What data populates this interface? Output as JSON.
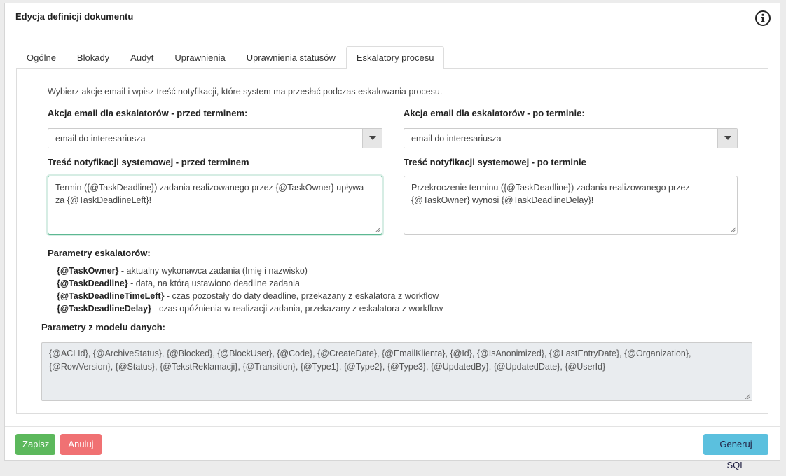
{
  "header": {
    "title": "Edycja definicji dokumentu",
    "info_icon": "info-circle-icon"
  },
  "tabs": [
    {
      "label": "Ogólne",
      "active": false
    },
    {
      "label": "Blokady",
      "active": false
    },
    {
      "label": "Audyt",
      "active": false
    },
    {
      "label": "Uprawnienia",
      "active": false
    },
    {
      "label": "Uprawnienia statusów",
      "active": false
    },
    {
      "label": "Eskalatory procesu",
      "active": true
    }
  ],
  "content": {
    "intro": "Wybierz akcje email i wpisz treść notyfikacji, które system ma przesłać podczas eskalowania procesu.",
    "before": {
      "email_label": "Akcja email dla eskalatorów - przed terminem:",
      "email_value": "email do interesariusza",
      "notif_label": "Treść notyfikacji systemowej - przed terminem",
      "notif_text": "Termin ({@TaskDeadline}) zadania realizowanego przez {@TaskOwner} upływa za {@TaskDeadlineLeft}!"
    },
    "after": {
      "email_label": "Akcja email dla eskalatorów - po terminie:",
      "email_value": "email do interesariusza",
      "notif_label": "Treść notyfikacji systemowej - po terminie",
      "notif_text": "Przekroczenie terminu ({@TaskDeadline}) zadania realizowanego przez {@TaskOwner} wynosi {@TaskDeadlineDelay}!"
    },
    "params_title": "Parametry eskalatorów:",
    "params": [
      {
        "name": "{@TaskOwner}",
        "desc": " - aktualny wykonawca zadania (Imię i nazwisko)"
      },
      {
        "name": "{@TaskDeadline}",
        "desc": " - data, na którą ustawiono deadline zadania"
      },
      {
        "name": "{@TaskDeadlineTimeLeft}",
        "desc": " - czas pozostały do daty deadline, przekazany z eskalatora z workflow"
      },
      {
        "name": "{@TaskDeadlineDelay}",
        "desc": " - czas opóźnienia w realizacji zadania, przekazany z eskalatora z workflow"
      }
    ],
    "model_title": "Parametry z modelu danych:",
    "model_text": "{@ACLId}, {@ArchiveStatus}, {@Blocked}, {@BlockUser}, {@Code}, {@CreateDate}, {@EmailKlienta}, {@Id}, {@IsAnonimized}, {@LastEntryDate}, {@Organization}, {@RowVersion}, {@Status}, {@TekstReklamacji}, {@Transition}, {@Type1}, {@Type2}, {@Type3}, {@UpdatedBy}, {@UpdatedDate}, {@UserId}"
  },
  "footer": {
    "save": "Zapisz",
    "cancel": "Anuluj",
    "sql": "Generuj SQL"
  },
  "colors": {
    "save": "#5cb85c",
    "cancel": "#f07173",
    "sql": "#5bc0de",
    "focus": "#5cb892"
  }
}
